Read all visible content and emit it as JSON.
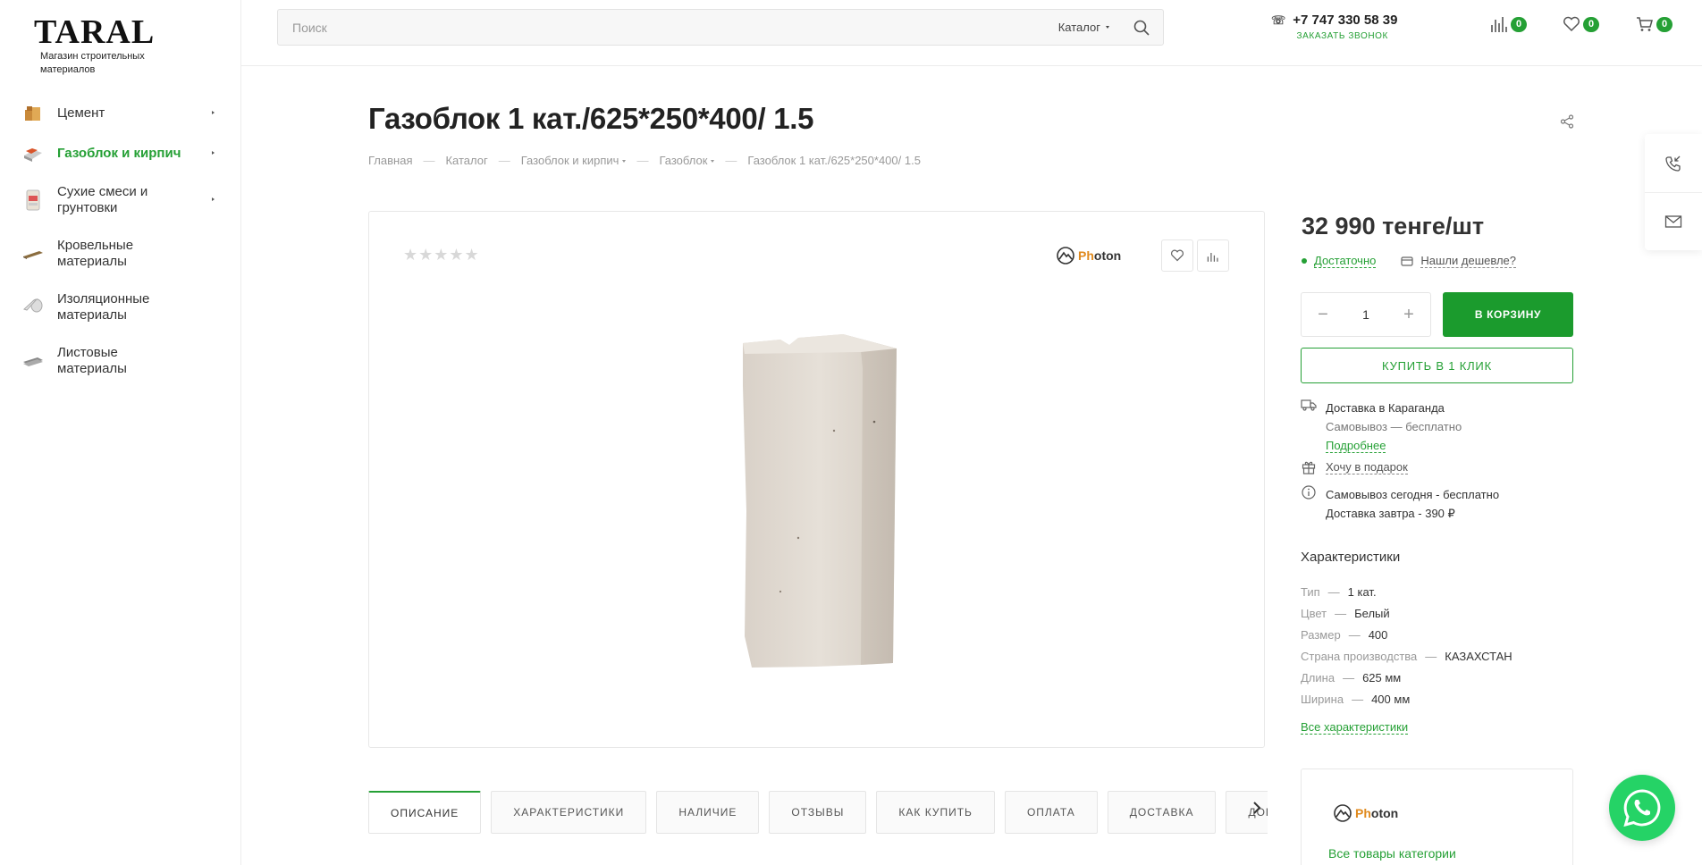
{
  "logo": {
    "title": "TARAL",
    "subtitle": "Магазин строительных материалов"
  },
  "sidebar": {
    "items": [
      {
        "label": "Цемент",
        "icon": "cement-bags-icon",
        "has_submenu": true,
        "active": false
      },
      {
        "label": "Газоблок и кирпич",
        "icon": "brick-icon",
        "has_submenu": true,
        "active": true
      },
      {
        "label": "Сухие смеси и грунтовки",
        "icon": "dry-mix-bag-icon",
        "has_submenu": true,
        "active": false
      },
      {
        "label": "Кровельные материалы",
        "icon": "roofing-icon",
        "has_submenu": false,
        "active": false
      },
      {
        "label": "Изоляционные материалы",
        "icon": "insulation-roll-icon",
        "has_submenu": false,
        "active": false
      },
      {
        "label": "Листовые материалы",
        "icon": "sheet-material-icon",
        "has_submenu": false,
        "active": false
      }
    ]
  },
  "header": {
    "search_placeholder": "Поиск",
    "catalog_label": "Каталог",
    "phone": "+7 747 330 58 39",
    "callback_label": "ЗАКАЗАТЬ ЗВОНОК",
    "compare_count": "0",
    "favorites_count": "0",
    "cart_count": "0"
  },
  "product": {
    "title": "Газоблок 1 кат./625*250*400/ 1.5",
    "stars": "★★★★★",
    "brand": "Photon",
    "price": "32 990 тенге/шт",
    "stock": "Достаточно",
    "cheaper": "Нашли дешевле?",
    "quantity": "1",
    "cart_label": "В КОРЗИНУ",
    "one_click_label": "КУПИТЬ В 1 КЛИК",
    "delivery_city": "Доставка в Караганда",
    "pickup_note": "Самовывоз — бесплатно",
    "more_link": "Подробнее",
    "gift_link": "Хочу в подарок",
    "pickup_today": "Самовывоз сегодня - бесплатно",
    "delivery_tomorrow": "Доставка завтра - 390 ₽"
  },
  "breadcrumb": [
    {
      "label": "Главная",
      "dropdown": false
    },
    {
      "label": "Каталог",
      "dropdown": false
    },
    {
      "label": "Газоблок и кирпич",
      "dropdown": true
    },
    {
      "label": "Газоблок",
      "dropdown": true
    },
    {
      "label": "Газоблок 1 кат./625*250*400/ 1.5",
      "dropdown": false
    }
  ],
  "characteristics": {
    "title": "Характеристики",
    "rows": [
      {
        "name": "Тип",
        "value": "1 кат."
      },
      {
        "name": "Цвет",
        "value": "Белый"
      },
      {
        "name": "Размер",
        "value": "400"
      },
      {
        "name": "Страна производства",
        "value": "КАЗАХСТАН"
      },
      {
        "name": "Длина",
        "value": "625 мм"
      },
      {
        "name": "Ширина",
        "value": "400 мм"
      }
    ],
    "all_link": "Все характеристики"
  },
  "tabs": [
    "ОПИСАНИЕ",
    "ХАРАКТЕРИСТИКИ",
    "НАЛИЧИЕ",
    "ОТЗЫВЫ",
    "КАК КУПИТЬ",
    "ОПЛАТА",
    "ДОСТАВКА",
    "ДОКУМЕНТЫ"
  ],
  "brand_card": {
    "brand": "Photon",
    "all_category_link": "Все товары категории"
  },
  "colors": {
    "accent": "#25a035",
    "button": "#1b9b2d",
    "whatsapp": "#25d366"
  }
}
